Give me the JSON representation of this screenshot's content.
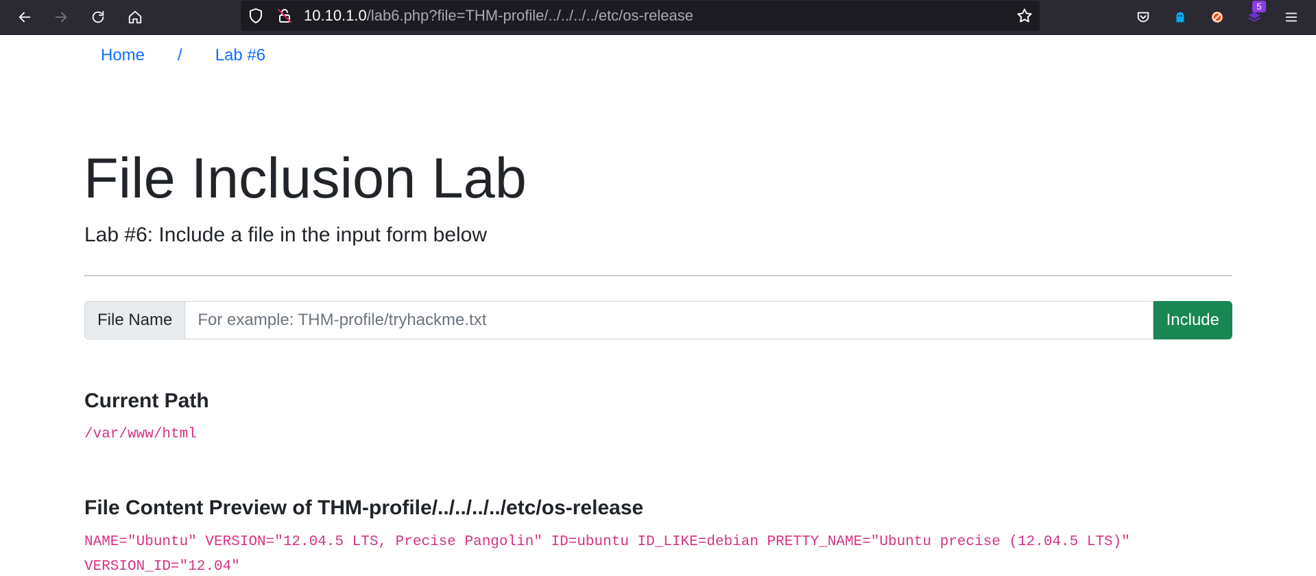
{
  "browser": {
    "url_host": "10.10.1.0",
    "url_path": "/lab6.php?file=THM-profile/../../../../etc/os-release",
    "extension_badge": "5"
  },
  "breadcrumb": {
    "home": "Home",
    "separator": "/",
    "current": "Lab #6"
  },
  "page": {
    "title": "File Inclusion Lab",
    "subtitle": "Lab #6: Include a file in the input form below"
  },
  "form": {
    "label": "File Name",
    "placeholder": "For example: THM-profile/tryhackme.txt",
    "value": "",
    "submit_label": "Include"
  },
  "current_path": {
    "heading": "Current Path",
    "value": "/var/www/html"
  },
  "preview": {
    "heading_prefix": "File Content Preview of",
    "file": "THM-profile/../../../../etc/os-release",
    "line1": "NAME=\"Ubuntu\" VERSION=\"12.04.5 LTS, Precise Pangolin\" ID=ubuntu ID_LIKE=debian PRETTY_NAME=\"Ubuntu precise (12.04.5 LTS)\"",
    "line2": "VERSION_ID=\"12.04\""
  }
}
